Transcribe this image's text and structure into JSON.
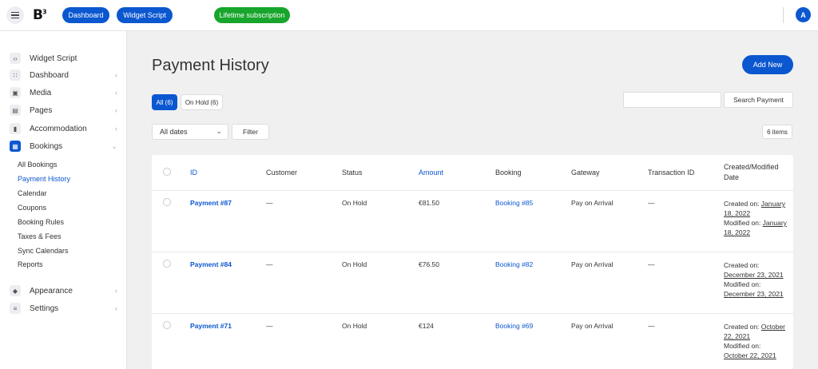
{
  "topbar": {
    "logo": "B",
    "logo_mark": "3",
    "dashboard_label": "Dashboard",
    "widget_script_label": "Widget Script",
    "subscription_label": "Lifetime subscription",
    "avatar_initial": "A",
    "accent": "#0b57d0",
    "subscription_color": "#17a52b"
  },
  "sidebar": {
    "items": [
      {
        "label": "Widget Script",
        "icon": "code-icon"
      },
      {
        "label": "Dashboard",
        "icon": "grid-icon"
      },
      {
        "label": "Media",
        "icon": "image-icon"
      },
      {
        "label": "Pages",
        "icon": "pages-icon"
      },
      {
        "label": "Accommodation",
        "icon": "building-icon"
      },
      {
        "label": "Bookings",
        "icon": "calendar-icon"
      },
      {
        "label": "Appearance",
        "icon": "paint-bucket-icon"
      },
      {
        "label": "Settings",
        "icon": "sliders-icon"
      }
    ],
    "bookings_sub": [
      "All Bookings",
      "Payment History",
      "Calendar",
      "Coupons",
      "Booking Rules",
      "Taxes & Fees",
      "Sync Calendars",
      "Reports"
    ]
  },
  "main": {
    "title": "Payment History",
    "add_new": "Add New",
    "tabs": [
      "All (6)",
      "On Hold (6)"
    ],
    "search_button": "Search Payment",
    "dates_select": "All dates",
    "filter_button": "Filter",
    "items_count": "6 items"
  },
  "table": {
    "headers": {
      "id": "ID",
      "customer": "Customer",
      "status": "Status",
      "amount": "Amount",
      "booking": "Booking",
      "gateway": "Gateway",
      "transaction": "Transaction ID",
      "date_line1": "Created/Modified",
      "date_line2": "Date"
    },
    "rows": [
      {
        "id": "Payment #87",
        "customer": "—",
        "status": "On Hold",
        "amount": "€81.50",
        "booking": "Booking #85",
        "gateway": "Pay on Arrival",
        "transaction": "—",
        "date_lines": [
          {
            "prefix": "Created on: ",
            "link": "January"
          },
          {
            "prefix": "",
            "link": "18, 2022"
          },
          {
            "prefix": "Modified on: ",
            "link": "January"
          },
          {
            "prefix": "",
            "link": "18, 2022"
          }
        ]
      },
      {
        "id": "Payment #84",
        "customer": "—",
        "status": "On Hold",
        "amount": "€76.50",
        "booking": "Booking #82",
        "gateway": "Pay on Arrival",
        "transaction": "—",
        "date_lines": [
          {
            "prefix": "Created on:",
            "link": ""
          },
          {
            "prefix": "",
            "link": "December 23, 2021"
          },
          {
            "prefix": "Modified on:",
            "link": ""
          },
          {
            "prefix": "",
            "link": "December 23, 2021"
          }
        ]
      },
      {
        "id": "Payment #71",
        "customer": "—",
        "status": "On Hold",
        "amount": "€124",
        "booking": "Booking #69",
        "gateway": "Pay on Arrival",
        "transaction": "—",
        "date_lines": [
          {
            "prefix": "Created on: ",
            "link": "October"
          },
          {
            "prefix": "",
            "link": "22, 2021"
          },
          {
            "prefix": "Modified on:",
            "link": ""
          },
          {
            "prefix": "",
            "link": "October 22, 2021"
          }
        ]
      }
    ]
  }
}
